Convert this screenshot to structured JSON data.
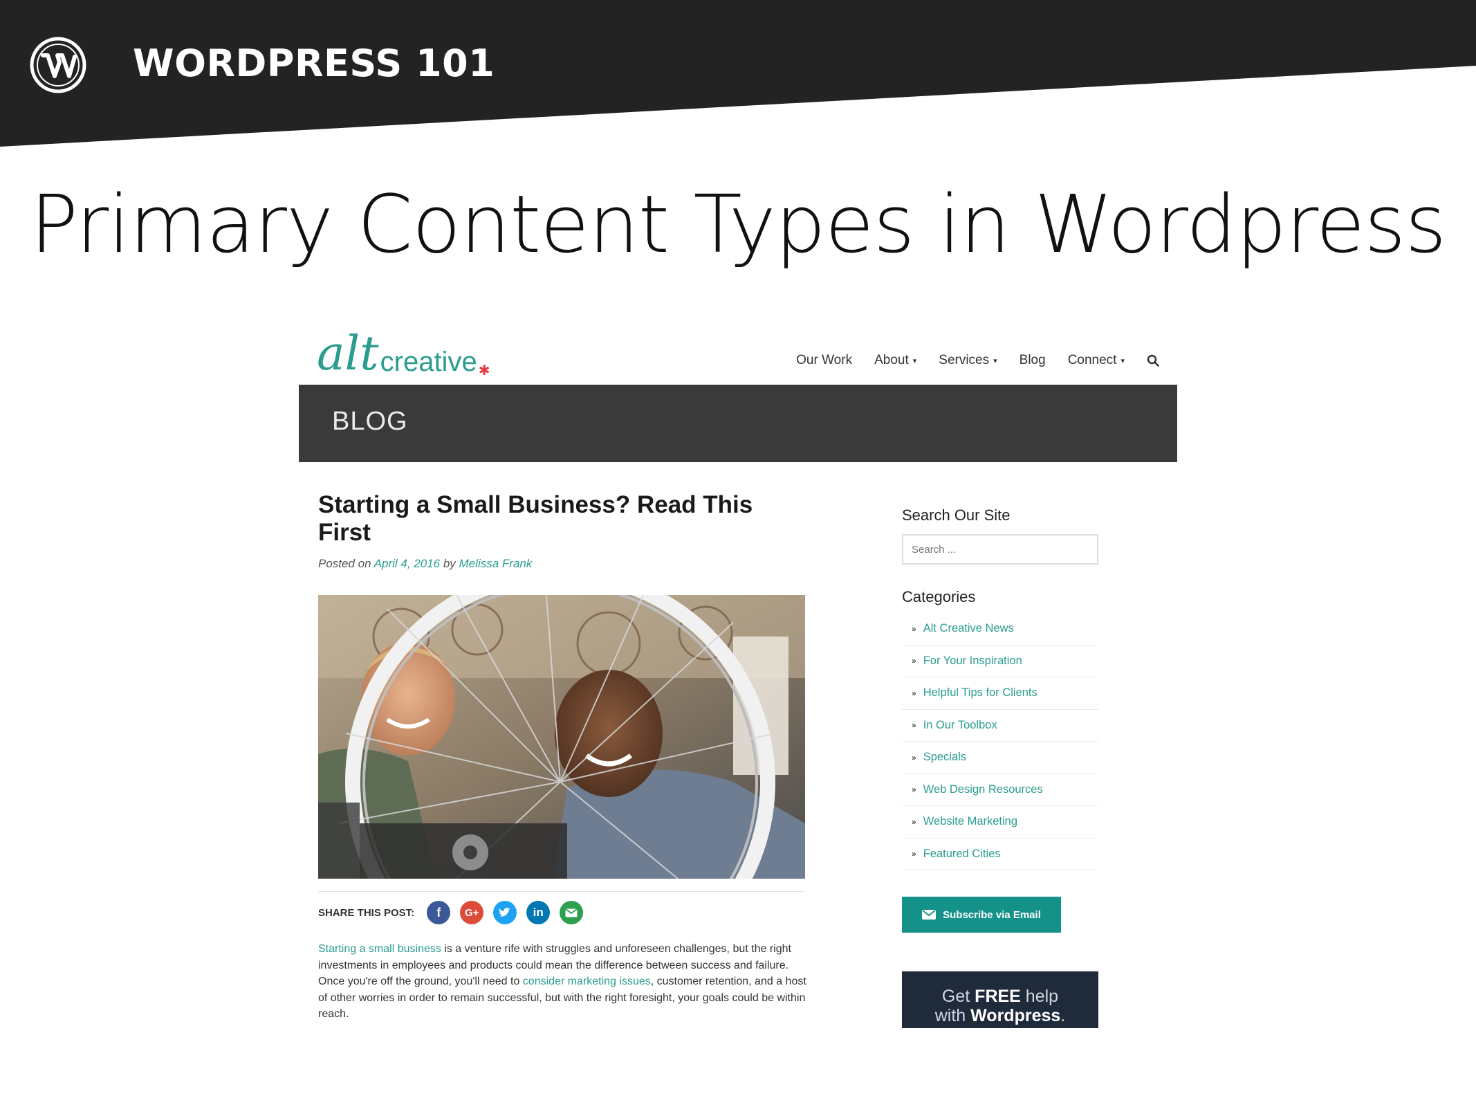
{
  "slide": {
    "deck_title": "WORDPRESS 101",
    "heading": "Primary Content Types in Wordpress"
  },
  "site": {
    "brand": {
      "alt": "alt",
      "creative": "creative"
    },
    "nav": {
      "items": [
        "Our Work",
        "About",
        "Services",
        "Blog",
        "Connect"
      ]
    },
    "blog_bar_title": "BLOG",
    "post": {
      "title": "Starting a Small Business? Read This First",
      "meta_prefix": "Posted on",
      "date": "April 4, 2016",
      "meta_by": "by",
      "author": "Melissa Frank",
      "share_label": "SHARE THIS POST:",
      "excerpt": {
        "link1": "Starting a small business",
        "text1": " is a venture rife with struggles and unforeseen challenges, but the right investments in employees and products could mean the difference between success and failure. Once you're off the ground, you'll need to ",
        "link2": "consider marketing issues",
        "text2": ", customer retention, and a host of other worries in order to remain successful, but with the right foresight, your goals could be within reach."
      }
    },
    "sidebar": {
      "search_heading": "Search Our Site",
      "search_placeholder": "Search ...",
      "categories_heading": "Categories",
      "categories": [
        "Alt Creative News",
        "For Your Inspiration",
        "Helpful Tips for Clients",
        "In Our Toolbox",
        "Specials",
        "Web Design Resources",
        "Website Marketing",
        "Featured Cities"
      ],
      "subscribe_label": "Subscribe via Email",
      "promo": {
        "line1_pre": "Get ",
        "line1_bold": "FREE",
        "line1_post": " help",
        "line2_pre": "with ",
        "line2_bold": "Wordpress",
        "line2_post": "."
      }
    }
  },
  "colors": {
    "header_band": "#232323",
    "accent_teal": "#2a9d8f",
    "blog_bar": "#3a3a3a",
    "subscribe": "#14928a",
    "facebook": "#3b5998",
    "google_plus": "#dd4b39",
    "twitter": "#1da1f2",
    "linkedin": "#0077b5",
    "email_share": "#2e9e4f"
  },
  "icons": [
    "wordpress-logo-icon",
    "search-icon",
    "facebook-icon",
    "google-plus-icon",
    "twitter-icon",
    "linkedin-icon",
    "email-icon",
    "envelope-icon",
    "chevron-right-icon"
  ]
}
